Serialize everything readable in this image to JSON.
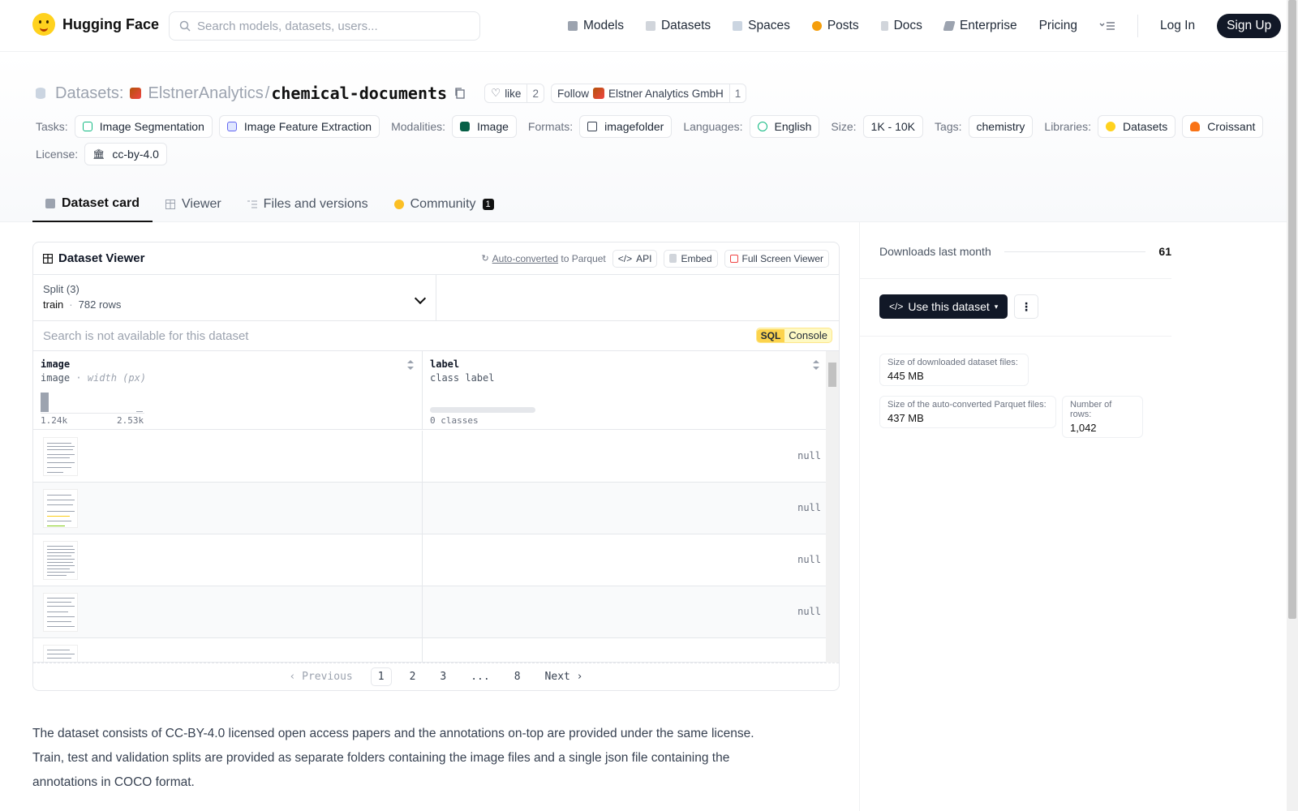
{
  "nav": {
    "brand": "Hugging Face",
    "search_placeholder": "Search models, datasets, users...",
    "links": [
      "Models",
      "Datasets",
      "Spaces",
      "Posts",
      "Docs",
      "Enterprise",
      "Pricing"
    ],
    "login": "Log In",
    "signup": "Sign Up"
  },
  "header": {
    "section": "Datasets:",
    "owner": "ElstnerAnalytics",
    "slash": "/",
    "name": "chemical-documents",
    "like_label": "like",
    "like_count": "2",
    "follow_label": "Follow",
    "follow_org": "Elstner Analytics GmbH",
    "follow_count": "1"
  },
  "tags": {
    "tasks_label": "Tasks:",
    "tasks": [
      "Image Segmentation",
      "Image Feature Extraction"
    ],
    "modalities_label": "Modalities:",
    "modality": "Image",
    "formats_label": "Formats:",
    "format": "imagefolder",
    "languages_label": "Languages:",
    "language": "English",
    "size_label": "Size:",
    "size": "1K - 10K",
    "tags_label": "Tags:",
    "tag": "chemistry",
    "libraries_label": "Libraries:",
    "libraries": [
      "Datasets",
      "Croissant"
    ],
    "license_label": "License:",
    "license": "cc-by-4.0"
  },
  "tabs": {
    "dataset_card": "Dataset card",
    "viewer": "Viewer",
    "files": "Files and versions",
    "community": "Community",
    "community_count": "1"
  },
  "viewer": {
    "title": "Dataset Viewer",
    "auto_converted": "Auto-converted",
    "to_parquet": "to Parquet",
    "api": "API",
    "embed": "Embed",
    "fullscreen": "Full Screen Viewer",
    "split_label": "Split (3)",
    "split_value": "train",
    "split_rows": "782 rows",
    "search_placeholder": "Search is not available for this dataset",
    "sql": "SQL",
    "console": "Console",
    "col1_name": "image",
    "col1_type": "image",
    "col1_sub": "width (px)",
    "col1_min": "1.24k",
    "col1_max": "2.53k",
    "col2_name": "label",
    "col2_type": "class label",
    "col2_classes": "0 classes",
    "null": "null",
    "pager": {
      "prev": "Previous",
      "pages": [
        "1",
        "2",
        "3",
        "...",
        "8"
      ],
      "next": "Next"
    }
  },
  "description": "The dataset consists of CC-BY-4.0 licensed open access papers and the annotations on-top are provided under the same license. Train, test and validation splits are provided as separate folders containing the image files and a single json file containing the annotations in COCO format.",
  "sidebar": {
    "downloads_label": "Downloads last month",
    "downloads_value": "61",
    "use_dataset": "Use this dataset",
    "size_files_label": "Size of downloaded dataset files:",
    "size_files_value": "445 MB",
    "size_parquet_label": "Size of the auto-converted Parquet files:",
    "size_parquet_value": "437 MB",
    "rows_label": "Number of rows:",
    "rows_value": "1,042"
  }
}
